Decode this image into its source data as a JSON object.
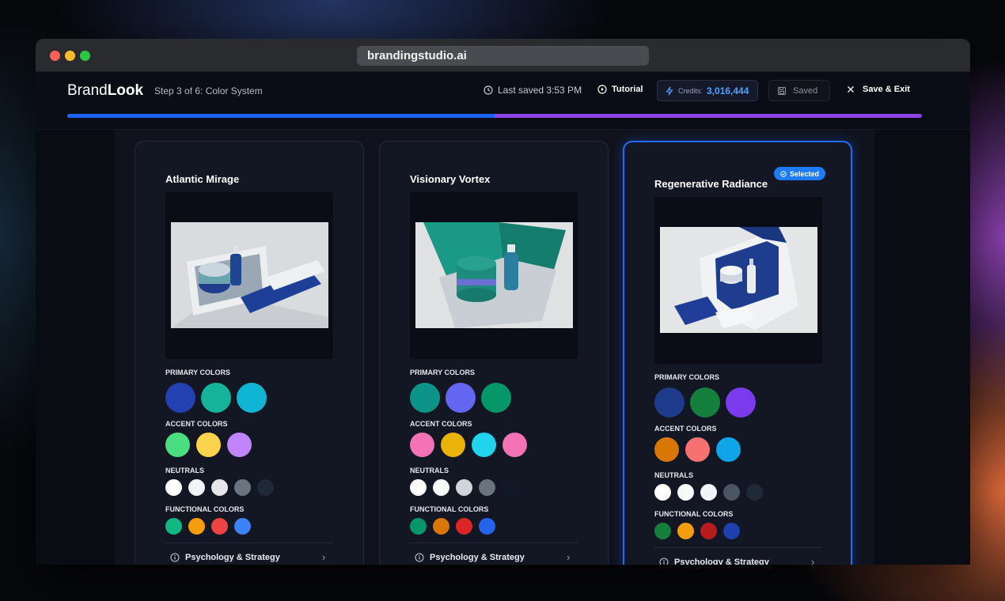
{
  "browser": {
    "url": "brandingstudio.ai"
  },
  "header": {
    "brand_prefix": "Brand",
    "brand_bold": "Look",
    "step": "Step 3 of 6:  Color System",
    "last_saved": "Last saved 3:53 PM",
    "tutorial": "Tutorial",
    "credits_label": "Credits:",
    "credits_value": "3,016,444",
    "saved_label": "Saved",
    "save_exit": "Save & Exit",
    "progress_fraction": 0.5
  },
  "labels": {
    "primary": "PRIMARY COLORS",
    "accent": "ACCENT COLORS",
    "neutrals": "NEUTRALS",
    "functional": "FUNCTIONAL COLORS",
    "psychology": "Psychology & Strategy",
    "selected": "Selected"
  },
  "cards": [
    {
      "title": "Atlantic Mirage",
      "selected": false,
      "primary": [
        "#2341b0",
        "#14b39a",
        "#10b5d4"
      ],
      "accent": [
        "#4ade80",
        "#fcd34d",
        "#c084fc"
      ],
      "neutrals": [
        "#ffffff",
        "#f3f4f6",
        "#e5e7eb",
        "#6b7280",
        "#1f2937"
      ],
      "functional": [
        "#10b981",
        "#f59e0b",
        "#ef4444",
        "#3b82f6"
      ]
    },
    {
      "title": "Visionary Vortex",
      "selected": false,
      "primary": [
        "#0d9488",
        "#6366f1",
        "#059669"
      ],
      "accent": [
        "#f472b6",
        "#eab308",
        "#22d3ee",
        "#f472b6"
      ],
      "neutrals": [
        "#ffffff",
        "#f9fafb",
        "#d1d5db",
        "#6b7280",
        "#111827"
      ],
      "functional": [
        "#059669",
        "#d97706",
        "#dc2626",
        "#2563eb"
      ]
    },
    {
      "title": "Regenerative Radiance",
      "selected": true,
      "primary": [
        "#1e3a8a",
        "#15803d",
        "#7c3aed"
      ],
      "accent": [
        "#d97706",
        "#f87171",
        "#0ea5e9"
      ],
      "neutrals": [
        "#ffffff",
        "#f8fafc",
        "#f1f5f9",
        "#4b5563",
        "#1f2937"
      ],
      "functional": [
        "#15803d",
        "#f59e0b",
        "#b91c1c",
        "#1e40af"
      ]
    }
  ]
}
